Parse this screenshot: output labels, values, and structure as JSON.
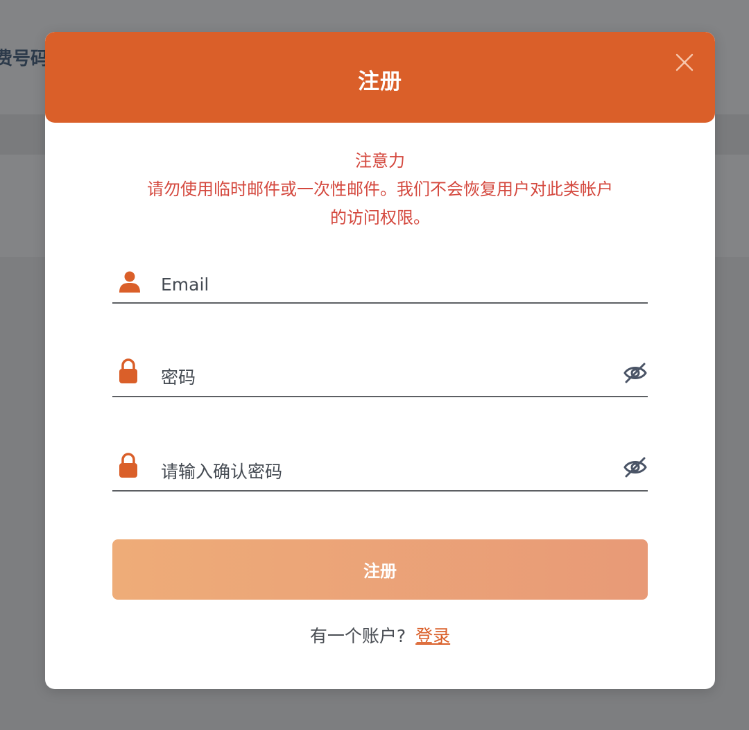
{
  "background": {
    "header_text": "费号码"
  },
  "modal": {
    "title": "注册",
    "close_icon": "close-icon",
    "notice": {
      "heading": "注意力",
      "line1": "请勿使用临时邮件或一次性邮件。我们不会恢复用户对此类帐户",
      "line2": "的访问权限。"
    },
    "fields": {
      "email": {
        "placeholder": "Email",
        "icon": "user-icon"
      },
      "password": {
        "placeholder": "密码",
        "icon": "lock-icon",
        "toggle_icon": "eye-off-icon"
      },
      "confirm_password": {
        "placeholder": "请输入确认密码",
        "icon": "lock-icon",
        "toggle_icon": "eye-off-icon"
      }
    },
    "submit_label": "注册",
    "footer": {
      "prompt": "有一个账户?",
      "link": "登录"
    }
  },
  "colors": {
    "brand": "#da5f29",
    "notice": "#d4483e",
    "button_start": "#eeac78",
    "button_end": "#e89a77"
  }
}
